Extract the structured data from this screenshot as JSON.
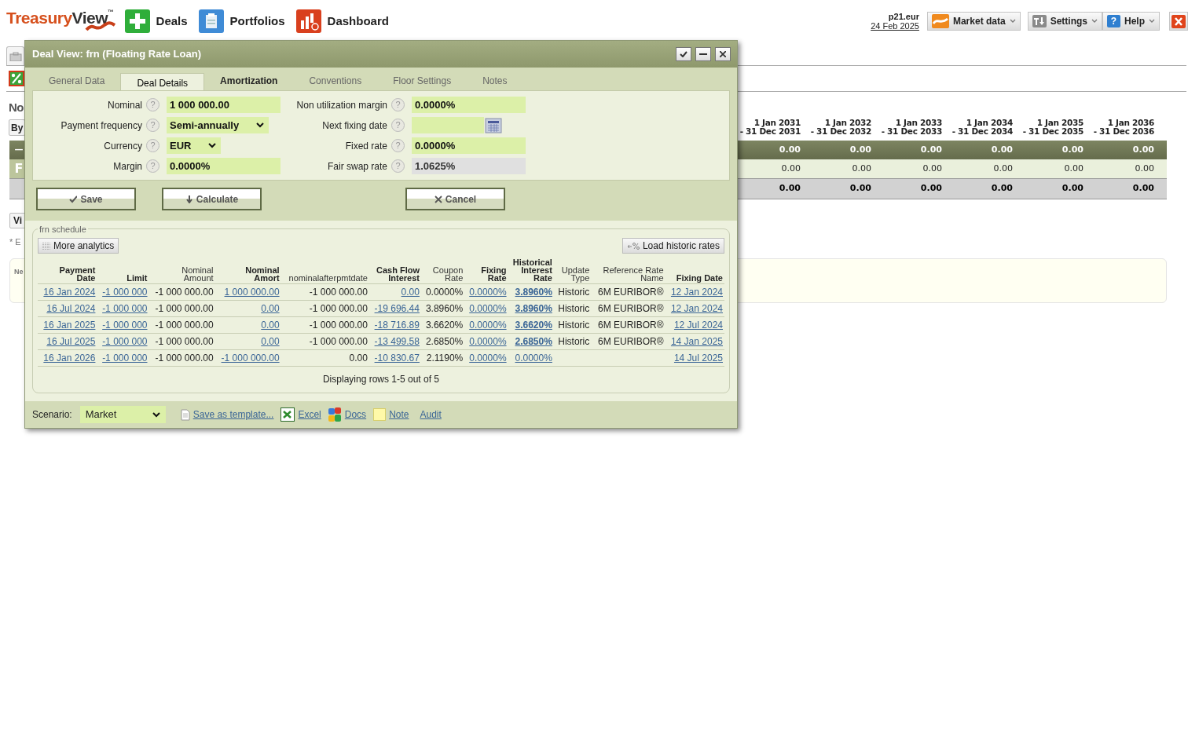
{
  "header": {
    "logo": {
      "text_a": "Treasury",
      "text_b": "View",
      "mark": "™"
    },
    "nav": [
      {
        "label": "Deals",
        "kind": "deals"
      },
      {
        "label": "Portfolios",
        "kind": "portfolios"
      },
      {
        "label": "Dashboard",
        "kind": "dashboard"
      }
    ],
    "user": "p21.eur",
    "date": "24 Feb 2025",
    "menus": [
      {
        "label": "Market data",
        "kind": "market"
      },
      {
        "label": "Settings",
        "kind": "settings"
      },
      {
        "label": "Help",
        "kind": "help",
        "glyph": "?"
      }
    ]
  },
  "background": {
    "heading": "No",
    "by_button": "By",
    "row_labels": [
      "—",
      "F"
    ],
    "periods": [
      {
        "from": "1 Jan 2031",
        "to": "- 31 Dec 2031"
      },
      {
        "from": "1 Jan 2032",
        "to": "- 31 Dec 2032"
      },
      {
        "from": "1 Jan 2033",
        "to": "- 31 Dec 2033"
      },
      {
        "from": "1 Jan 2034",
        "to": "- 31 Dec 2034"
      },
      {
        "from": "1 Jan 2035",
        "to": "- 31 Dec 2035"
      },
      {
        "from": "1 Jan 2036",
        "to": "- 31 Dec 2036"
      }
    ],
    "rows": [
      {
        "kind": "group",
        "values": [
          "0.00",
          "0.00",
          "0.00",
          "0.00",
          "0.00",
          "0.00"
        ]
      },
      {
        "kind": "item",
        "values": [
          "0.00",
          "0.00",
          "0.00",
          "0.00",
          "0.00",
          "0.00"
        ]
      },
      {
        "kind": "total",
        "values": [
          "0.00",
          "0.00",
          "0.00",
          "0.00",
          "0.00",
          "0.00"
        ]
      }
    ],
    "view_button": "Vi",
    "footnote": "* E",
    "note_label": "Ne"
  },
  "dialog": {
    "title": "Deal View: frn (Floating Rate Loan)",
    "tabs": [
      {
        "label": "General Data",
        "selected": false,
        "emphasized": false
      },
      {
        "label": "Deal Details",
        "selected": true,
        "emphasized": false
      },
      {
        "label": "Amortization",
        "selected": false,
        "emphasized": true
      },
      {
        "label": "Conventions",
        "selected": false,
        "emphasized": false
      },
      {
        "label": "Floor Settings",
        "selected": false,
        "emphasized": false
      },
      {
        "label": "Notes",
        "selected": false,
        "emphasized": false
      }
    ],
    "fields": [
      {
        "label": "Nominal",
        "hint": "?",
        "kind": "text",
        "value": "1 000 000.00"
      },
      {
        "label": "Non utilization margin",
        "hint": "?",
        "kind": "text",
        "value": "0.0000%"
      },
      {
        "label": "Payment frequency",
        "hint": "?",
        "kind": "select",
        "value": "Semi-annually"
      },
      {
        "label": "Next fixing date",
        "hint": "?",
        "kind": "date"
      },
      {
        "label": "Currency",
        "hint": "?",
        "kind": "select",
        "value": "EUR"
      },
      {
        "label": "Fixed rate",
        "hint": "?",
        "kind": "text",
        "value": "0.0000%"
      },
      {
        "label": "Margin",
        "hint": "?",
        "kind": "text",
        "value": "0.0000%"
      },
      {
        "label": "Fair swap rate",
        "hint": "?",
        "kind": "readonly",
        "value": "1.0625%"
      }
    ],
    "buttons": [
      {
        "label": "Save",
        "kind": "save"
      },
      {
        "label": "Calculate",
        "kind": "calculate"
      },
      {
        "label": "Cancel",
        "kind": "cancel"
      }
    ],
    "schedule": {
      "legend": "frn schedule",
      "analytics_button": "More analytics",
      "historic_button": "Load historic rates",
      "columns": [
        {
          "label": [
            "Payment",
            "Date"
          ],
          "bold": true,
          "kind": "link"
        },
        {
          "label": [
            "Limit"
          ],
          "bold": true,
          "kind": "link"
        },
        {
          "label": [
            "Nominal",
            "Amount"
          ],
          "bold": false,
          "kind": "text"
        },
        {
          "label": [
            "Nominal",
            "Amort"
          ],
          "bold": true,
          "kind": "link"
        },
        {
          "label": [
            "nominalafterpmtdate"
          ],
          "bold": false,
          "kind": "text"
        },
        {
          "label": [
            "Cash Flow",
            "Interest"
          ],
          "bold": true,
          "kind": "link"
        },
        {
          "label": [
            "Coupon",
            "Rate"
          ],
          "bold": false,
          "kind": "text"
        },
        {
          "label": [
            "Fixing",
            "Rate"
          ],
          "bold": true,
          "kind": "link"
        },
        {
          "label": [
            "Historical",
            "Interest",
            "Rate"
          ],
          "bold": true,
          "kind": "rate-link"
        },
        {
          "label": [
            "Update",
            "Type"
          ],
          "bold": false,
          "kind": "text"
        },
        {
          "label": [
            "Reference Rate",
            "Name"
          ],
          "bold": false,
          "kind": "text"
        },
        {
          "label": [
            "Fixing Date"
          ],
          "bold": true,
          "kind": "link"
        }
      ],
      "rows": [
        {
          "historic": true,
          "cells": [
            "16 Jan 2024",
            "-1 000 000",
            "-1 000 000.00",
            "1 000 000.00",
            "-1 000 000.00",
            "0.00",
            "0.0000%",
            "0.0000%",
            "3.8960%",
            "Historic",
            "6M EURIBOR®",
            "12 Jan 2024"
          ]
        },
        {
          "historic": true,
          "cells": [
            "16 Jul 2024",
            "-1 000 000",
            "-1 000 000.00",
            "0.00",
            "-1 000 000.00",
            "-19 696.44",
            "3.8960%",
            "0.0000%",
            "3.8960%",
            "Historic",
            "6M EURIBOR®",
            "12 Jan 2024"
          ]
        },
        {
          "historic": true,
          "cells": [
            "16 Jan 2025",
            "-1 000 000",
            "-1 000 000.00",
            "0.00",
            "-1 000 000.00",
            "-18 716.89",
            "3.6620%",
            "0.0000%",
            "3.6620%",
            "Historic",
            "6M EURIBOR®",
            "12 Jul 2024"
          ]
        },
        {
          "historic": true,
          "cells": [
            "16 Jul 2025",
            "-1 000 000",
            "-1 000 000.00",
            "0.00",
            "-1 000 000.00",
            "-13 499.58",
            "2.6850%",
            "0.0000%",
            "2.6850%",
            "Historic",
            "6M EURIBOR®",
            "14 Jan 2025"
          ]
        },
        {
          "historic": false,
          "cells": [
            "16 Jan 2026",
            "-1 000 000",
            "-1 000 000.00",
            "-1 000 000.00",
            "0.00",
            "-10 830.67",
            "2.1190%",
            "0.0000%",
            "0.0000%",
            null,
            null,
            "14 Jul 2025"
          ]
        }
      ],
      "summary": "Displaying rows 1-5 out of 5"
    },
    "footer": {
      "scenario_label": "Scenario:",
      "scenario": "Market",
      "links": [
        {
          "label": "Save as template...",
          "kind": "template"
        },
        {
          "label": "Excel",
          "kind": "excel"
        },
        {
          "label": "Docs",
          "kind": "docs"
        },
        {
          "label": "Note",
          "kind": "note"
        },
        {
          "label": "Audit",
          "kind": "audit"
        }
      ]
    }
  }
}
